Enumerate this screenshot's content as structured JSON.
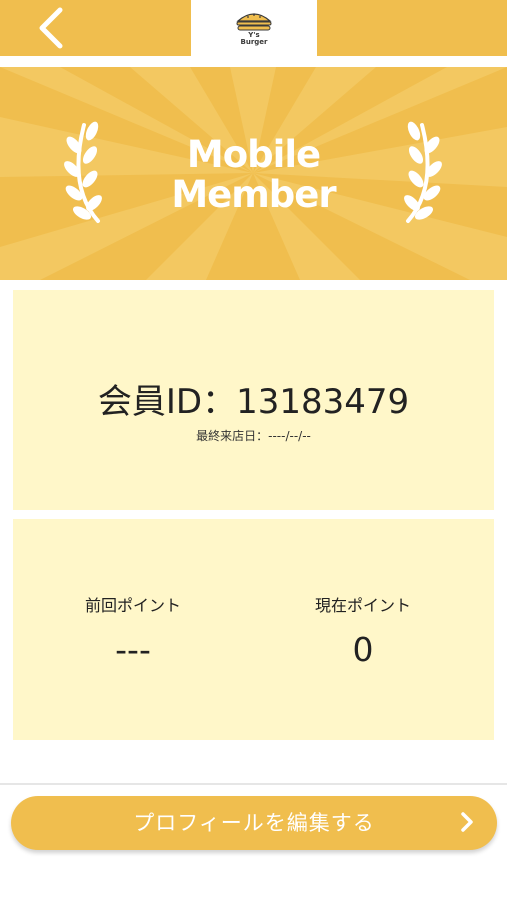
{
  "header": {
    "logo_line1": "Y's",
    "logo_line2": "Burger",
    "back_icon": "chevron-left-icon"
  },
  "banner": {
    "title_line1": "Mobile",
    "title_line2": "Member",
    "icons": [
      "laurel-left-icon",
      "laurel-right-icon"
    ]
  },
  "member": {
    "id_text": "会員ID：13183479",
    "last_visit": "最終来店日：----/--/--"
  },
  "points": {
    "previous_label": "前回ポイント",
    "previous_value": "---",
    "current_label": "現在ポイント",
    "current_value": "0"
  },
  "actions": {
    "edit_profile_label": "プロフィールを編集する",
    "chevron_icon": "chevron-right-icon"
  },
  "colors": {
    "brand": "#F0BE4E",
    "card_bg": "#FFF7C9",
    "text": "#222222"
  }
}
